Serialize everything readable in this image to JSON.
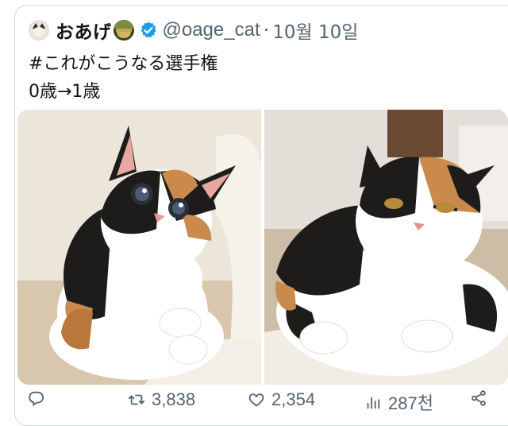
{
  "tweet": {
    "display_name": "おあげ",
    "handle": "@oage_cat",
    "separator": "·",
    "date": "10월 10일",
    "text_line1": "#これがこうなる選手権",
    "text_line2": "0歳→1歳"
  },
  "media": {
    "left_image": "calico kitten sitting on a chair",
    "right_image": "grown calico cat lying on a chair"
  },
  "actions": {
    "reply_count": "",
    "retweet_count": "3,838",
    "like_count": "2,354",
    "views_count": "287천"
  },
  "colors": {
    "text_primary": "#0f1419",
    "text_secondary": "#536471",
    "verified_blue": "#1d9bf0",
    "border": "#cfd9de"
  },
  "icons": {
    "reply": "reply-icon",
    "retweet": "retweet-icon",
    "like": "like-icon",
    "views": "views-icon",
    "share": "share-icon",
    "verified": "verified-badge-icon"
  }
}
